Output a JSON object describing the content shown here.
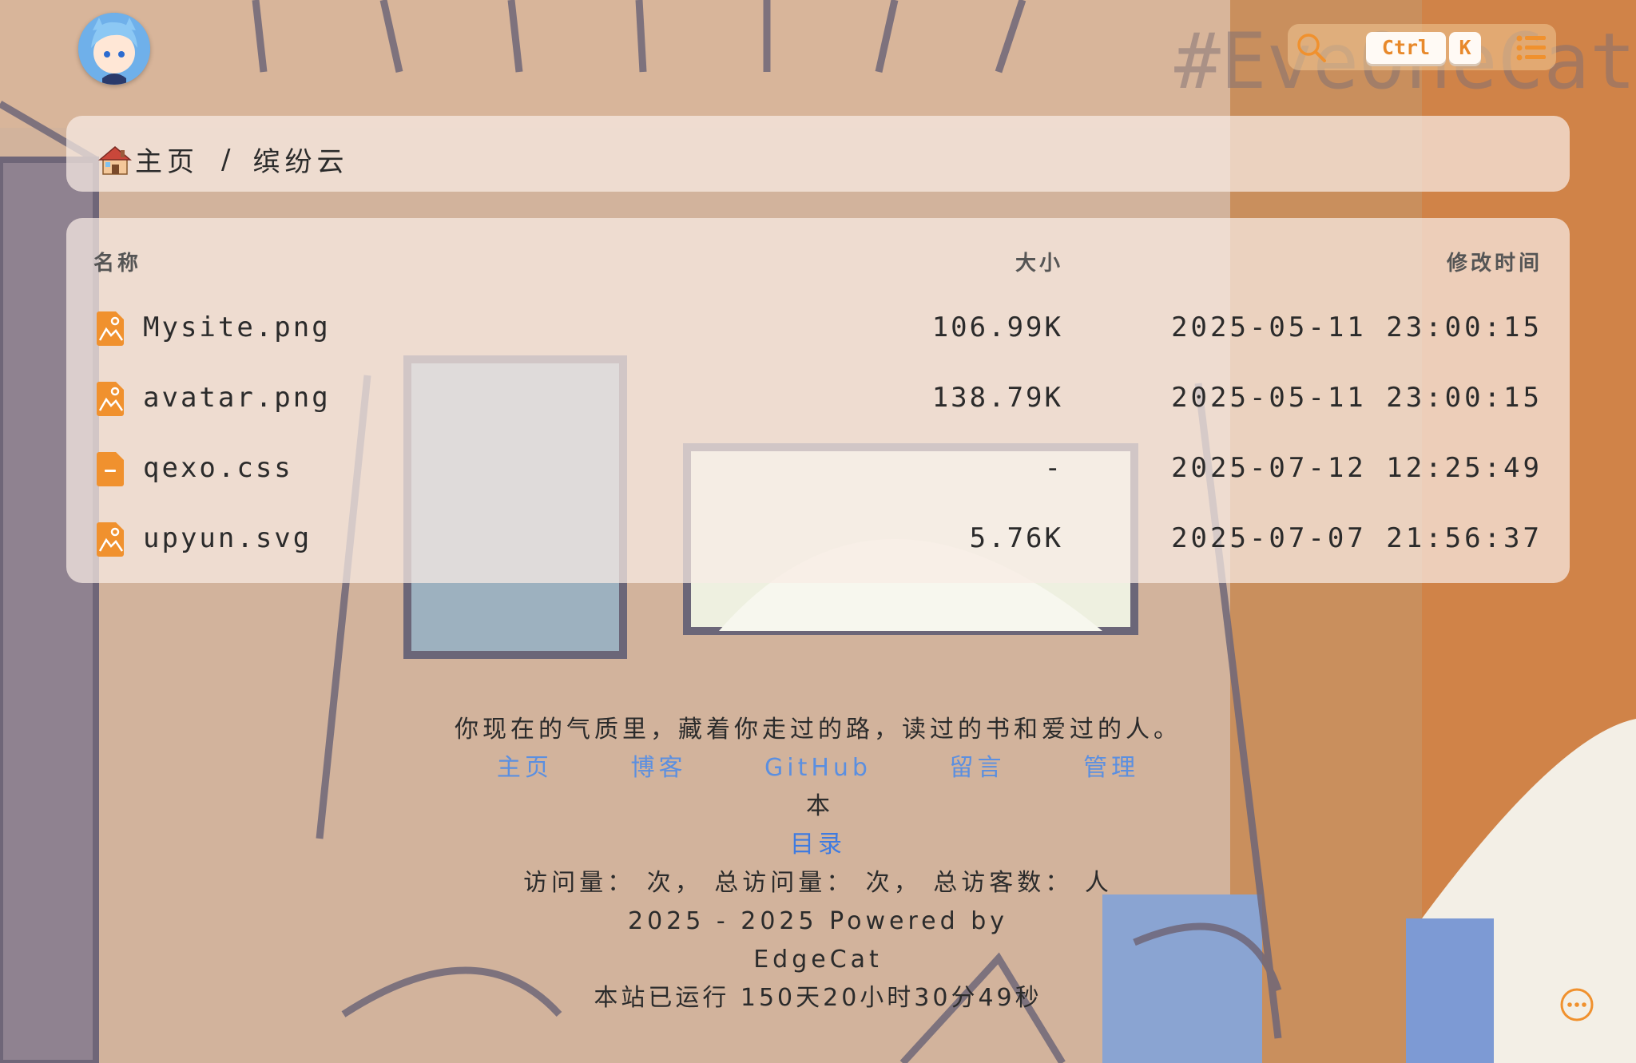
{
  "header": {
    "avatar_alt": "avatar",
    "shortcut_ctrl": "Ctrl",
    "shortcut_k": "K",
    "watermark": "#EveOneCat"
  },
  "breadcrumb": {
    "home_label": "主页",
    "separator": "/",
    "current": "缤纷云"
  },
  "table": {
    "columns": [
      "名称",
      "大小",
      "修改时间"
    ],
    "rows": [
      {
        "icon": "image-file-icon",
        "name": "Mysite.png",
        "size": "106.99K",
        "modified": "2025-05-11 23:00:15"
      },
      {
        "icon": "image-file-icon",
        "name": "avatar.png",
        "size": "138.79K",
        "modified": "2025-05-11 23:00:15"
      },
      {
        "icon": "generic-file-icon",
        "name": "qexo.css",
        "size": "-",
        "modified": "2025-07-12 12:25:49"
      },
      {
        "icon": "image-file-icon",
        "name": "upyun.svg",
        "size": "5.76K",
        "modified": "2025-07-07 21:56:37"
      }
    ]
  },
  "footer": {
    "quote": "你现在的气质里，藏着你走过的路，读过的书和爱过的人。",
    "links": [
      "主页",
      "博客",
      "GitHub",
      "留言",
      "管理"
    ],
    "ben": "本",
    "toc": "目录",
    "stats": "访问量： 次， 总访问量： 次， 总访客数： 人",
    "powered_line1": "2025 - 2025 Powered by",
    "powered_line2": "EdgeCat",
    "uptime": "本站已运行 150天20小时30分49秒"
  },
  "colors": {
    "accent": "#f0912e",
    "link": "#5b8fe0",
    "card": "#f8ece4"
  }
}
